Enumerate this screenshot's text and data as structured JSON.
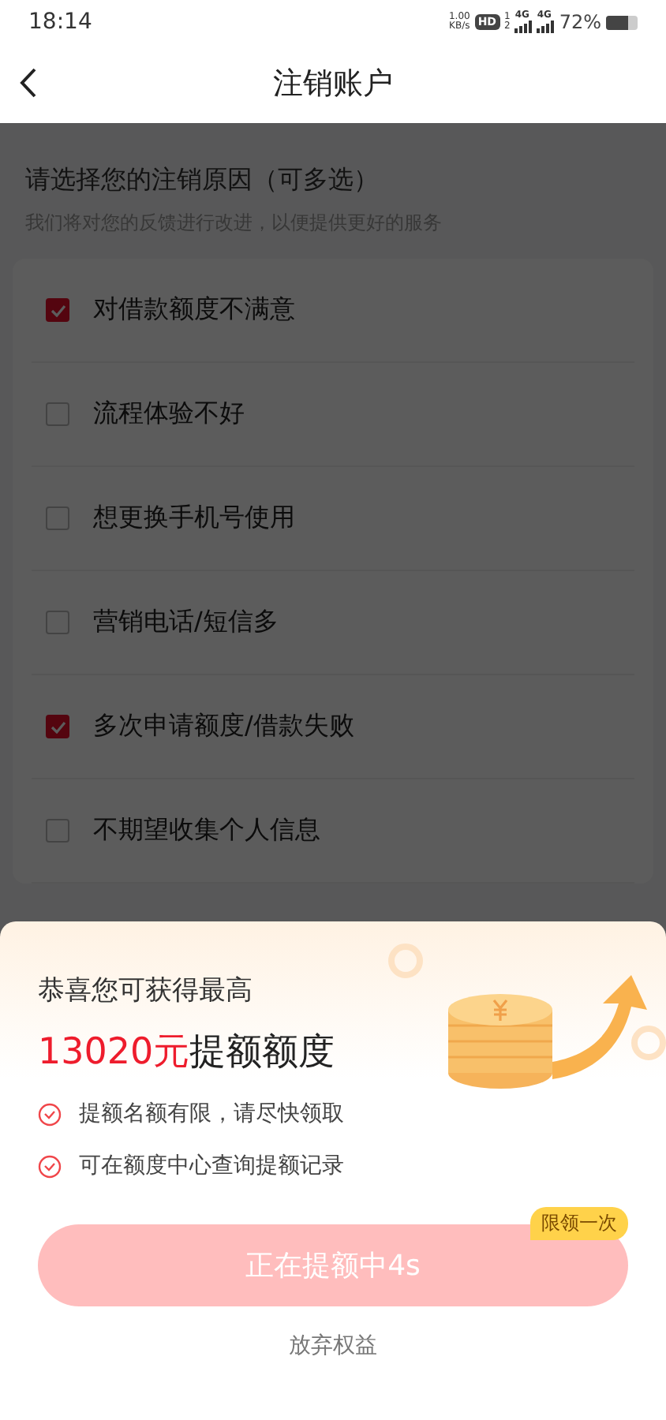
{
  "status_bar": {
    "time": "18:14",
    "speed_value": "1.00",
    "speed_unit": "KB/s",
    "hd_badge": "HD",
    "sim_slots": [
      "1",
      "2"
    ],
    "networks": [
      "4G",
      "4G"
    ],
    "battery_percent": "72%"
  },
  "header": {
    "title": "注销账户"
  },
  "reasons": {
    "title": "请选择您的注销原因（可多选）",
    "subtitle": "我们将对您的反馈进行改进，以便提供更好的服务",
    "options": [
      {
        "label": "对借款额度不满意",
        "checked": true
      },
      {
        "label": "流程体验不好",
        "checked": false
      },
      {
        "label": "想更换手机号使用",
        "checked": false
      },
      {
        "label": "营销电话/短信多",
        "checked": false
      },
      {
        "label": "多次申请额度/借款失败",
        "checked": true
      },
      {
        "label": "不期望收集个人信息",
        "checked": false
      }
    ]
  },
  "offer_sheet": {
    "heading": "恭喜您可获得最高",
    "amount": "13020元",
    "amount_suffix": "提额额度",
    "benefits": [
      "提额名额有限，请尽快领取",
      "可在额度中心查询提额记录"
    ],
    "button": {
      "label": "正在提额中4s",
      "disabled": true
    },
    "badge": "限领一次",
    "decline_link": "放弃权益"
  }
}
